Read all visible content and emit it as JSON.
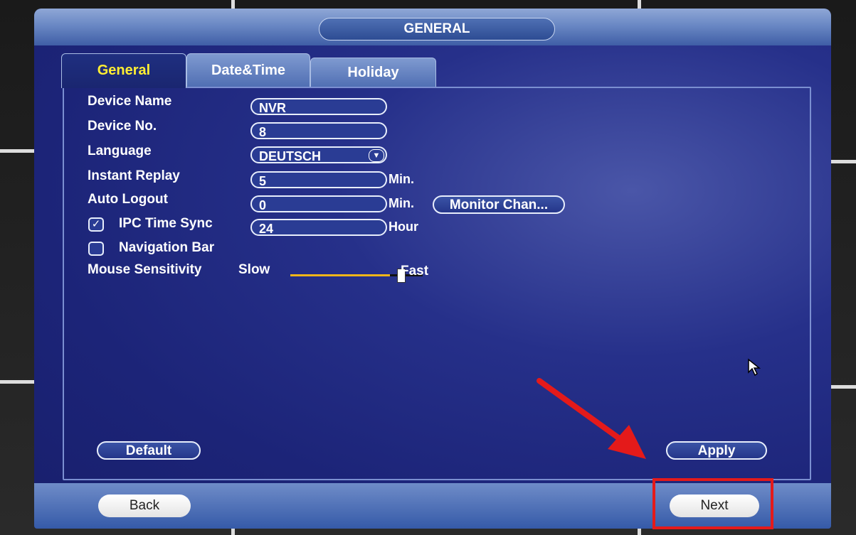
{
  "window": {
    "title": "GENERAL"
  },
  "tabs": [
    {
      "label": "General",
      "active": true
    },
    {
      "label": "Date&Time",
      "active": false
    },
    {
      "label": "Holiday",
      "active": false
    }
  ],
  "fields": {
    "device_name": {
      "label": "Device Name",
      "value": "NVR"
    },
    "device_no": {
      "label": "Device No.",
      "value": "8"
    },
    "language": {
      "label": "Language",
      "value": "DEUTSCH"
    },
    "instant_replay": {
      "label": "Instant Replay",
      "value": "5",
      "unit": "Min."
    },
    "auto_logout": {
      "label": "Auto Logout",
      "value": "0",
      "unit": "Min."
    },
    "ipc_time_sync": {
      "label": "IPC Time Sync",
      "checked": true,
      "value": "24",
      "unit": "Hour"
    },
    "navigation_bar": {
      "label": "Navigation Bar",
      "checked": false
    },
    "mouse_sensitivity": {
      "label": "Mouse Sensitivity",
      "min_label": "Slow",
      "max_label": "Fast",
      "level": 0.77
    }
  },
  "buttons": {
    "monitor_channel": "Monitor Chan...",
    "default": "Default",
    "apply": "Apply",
    "back": "Back",
    "next": "Next"
  },
  "colors": {
    "active_tab_text": "#ffee33",
    "slider_fill": "#f2b619",
    "annotation_red": "#e41a1a"
  }
}
